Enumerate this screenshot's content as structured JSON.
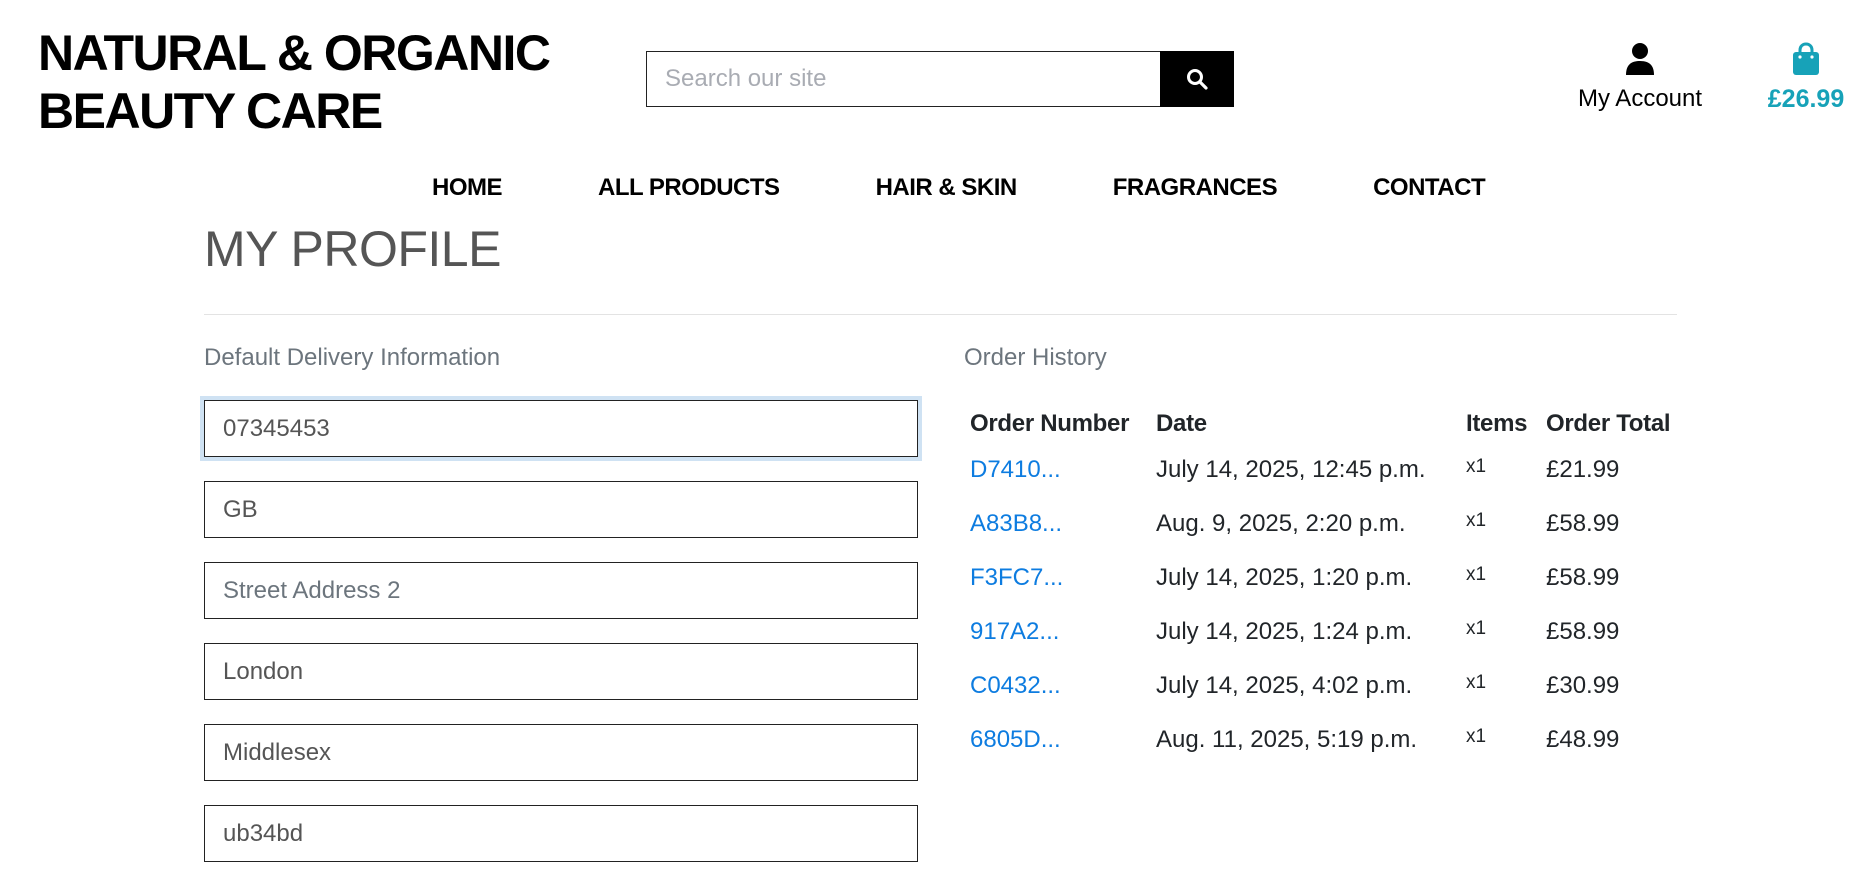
{
  "brand": {
    "line1": "NATURAL & ORGANIC",
    "line2": "BEAUTY CARE"
  },
  "search": {
    "placeholder": "Search our site",
    "value": "",
    "icon": "search-icon"
  },
  "account": {
    "label": "My Account",
    "icon": "user-icon"
  },
  "bag": {
    "amount": "£26.99",
    "icon": "shopping-bag-icon",
    "color": "#17a2b8"
  },
  "nav": {
    "items": [
      {
        "label": "HOME"
      },
      {
        "label": "ALL PRODUCTS"
      },
      {
        "label": "HAIR & SKIN"
      },
      {
        "label": "FRAGRANCES"
      },
      {
        "label": "CONTACT"
      }
    ]
  },
  "page_title": "MY PROFILE",
  "delivery": {
    "heading": "Default Delivery Information",
    "fields": [
      {
        "value": "07345453",
        "placeholder": ""
      },
      {
        "value": "GB",
        "placeholder": ""
      },
      {
        "value": "",
        "placeholder": "Street Address 2"
      },
      {
        "value": "London",
        "placeholder": ""
      },
      {
        "value": "Middlesex",
        "placeholder": ""
      },
      {
        "value": "ub34bd",
        "placeholder": ""
      }
    ]
  },
  "orders": {
    "heading": "Order History",
    "columns": [
      "Order Number",
      "Date",
      "Items",
      "Order Total"
    ],
    "rows": [
      {
        "number": "D7410...",
        "date": "July 14, 2025, 12:45 p.m.",
        "items": "x1",
        "total": "£21.99"
      },
      {
        "number": "A83B8...",
        "date": "Aug. 9, 2025, 2:20 p.m.",
        "items": "x1",
        "total": "£58.99"
      },
      {
        "number": "F3FC7...",
        "date": "July 14, 2025, 1:20 p.m.",
        "items": "x1",
        "total": "£58.99"
      },
      {
        "number": "917A2...",
        "date": "July 14, 2025, 1:24 p.m.",
        "items": "x1",
        "total": "£58.99"
      },
      {
        "number": "C0432...",
        "date": "July 14, 2025, 4:02 p.m.",
        "items": "x1",
        "total": "£30.99"
      },
      {
        "number": "6805D...",
        "date": "Aug. 11, 2025, 5:19 p.m.",
        "items": "x1",
        "total": "£48.99"
      }
    ],
    "link_color": "#0d7ce0"
  }
}
